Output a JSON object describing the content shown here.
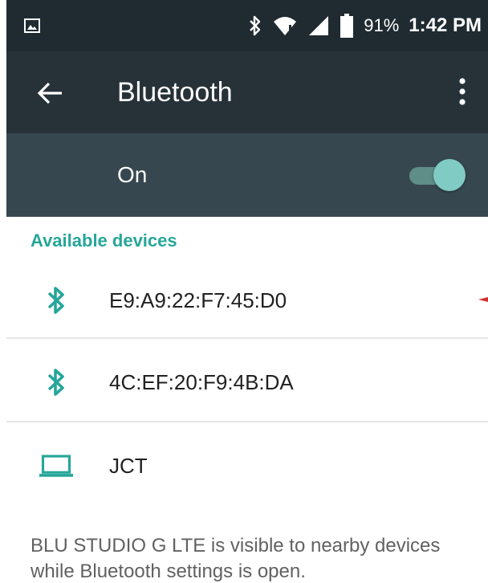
{
  "status_bar": {
    "battery_percent": "91%",
    "time": "1:42 PM",
    "icons": [
      "image-icon",
      "bluetooth-icon",
      "wifi-icon",
      "cell-signal-icon",
      "battery-icon"
    ]
  },
  "toolbar": {
    "title": "Bluetooth",
    "back_icon": "arrow-back-icon",
    "menu_icon": "more-vert-icon"
  },
  "switch_bar": {
    "label": "On",
    "enabled": true
  },
  "available_devices": {
    "header": "Available devices",
    "items": [
      {
        "name": "E9:A9:22:F7:45:D0",
        "icon": "bluetooth-icon"
      },
      {
        "name": "4C:EF:20:F9:4B:DA",
        "icon": "bluetooth-icon"
      },
      {
        "name": "JCT",
        "icon": "laptop-icon"
      }
    ]
  },
  "footer": {
    "text": "BLU STUDIO G LTE is visible to nearby devices while Bluetooth settings is open."
  },
  "colors": {
    "status_bar": "#1f2b31",
    "toolbar": "#263238",
    "switch_bar": "#37474f",
    "accent": "#26a69a",
    "toggle_thumb": "#80cbc4"
  }
}
